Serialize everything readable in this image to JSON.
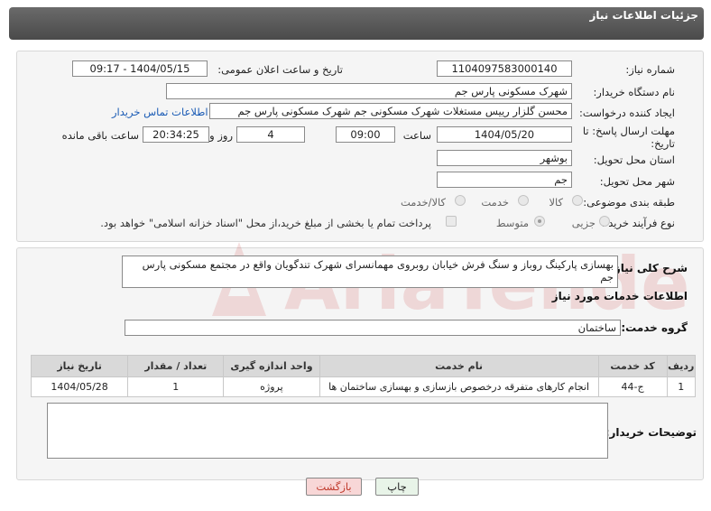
{
  "header": {
    "title": "جزئیات اطلاعات نیاز"
  },
  "labels": {
    "need_number": "شماره نیاز:",
    "announce_datetime": "تاریخ و ساعت اعلان عمومی:",
    "buyer_org": "نام دستگاه خریدار:",
    "requester": "ایجاد کننده درخواست:",
    "deadline": "مهلت ارسال پاسخ: تا تاریخ:",
    "time": "ساعت",
    "days_and": "روز و",
    "remaining": "ساعت باقی مانده",
    "province": "استان محل تحویل:",
    "city": "شهر محل تحویل:",
    "category": "طبقه بندی موضوعی:",
    "process_type": "نوع فرآیند خرید :",
    "general_desc": "شرح کلی نیاز:",
    "services_info": "اطلاعات خدمات مورد نیاز",
    "service_group": "گروه خدمت:",
    "buyer_notes": "توضیحات خریدار:"
  },
  "fields": {
    "need_number": "1104097583000140",
    "announce_datetime": "1404/05/15 - 09:17",
    "buyer_org": "شهرک مسکونی پارس جم",
    "requester": "محسن گلزار رییس مستغلات شهرک مسکونی جم شهرک مسکونی پارس جم",
    "contact_link": "اطلاعات تماس خریدار",
    "deadline_date": "1404/05/20",
    "deadline_time": "09:00",
    "days": "4",
    "remaining_time": "20:34:25",
    "province": "بوشهر",
    "city": "جم",
    "general_desc": "بهسازی پارکینگ روباز و سنگ فرش خیابان روبروی مهمانسرای شهرک تندگویان واقع در مجتمع مسکونی پارس جم",
    "service_group": "ساختمان",
    "buyer_notes": ""
  },
  "category_options": [
    {
      "label": "کالا",
      "selected": false
    },
    {
      "label": "خدمت",
      "selected": false
    },
    {
      "label": "کالا/خدمت",
      "selected": false
    }
  ],
  "process_options": [
    {
      "label": "جزیی",
      "selected": false
    },
    {
      "label": "متوسط",
      "selected": true
    }
  ],
  "payment_note": "پرداخت تمام یا بخشی از مبلغ خرید،از محل \"اسناد خزانه اسلامی\" خواهد بود.",
  "table": {
    "headers": [
      "ردیف",
      "کد خدمت",
      "نام خدمت",
      "واحد اندازه گیری",
      "تعداد / مقدار",
      "تاریخ نیاز"
    ],
    "rows": [
      [
        "1",
        "ج-44",
        "انجام کارهای متفرقه درخصوص بازسازی و بهسازی ساختمان ها",
        "پروژه",
        "1",
        "1404/05/28"
      ]
    ]
  },
  "buttons": {
    "print": "چاپ",
    "back": "بازگشت"
  },
  "watermark": {
    "text": "AriaTender.neT"
  },
  "colors": {
    "header_bg": "#555555",
    "link": "#1a5bb5",
    "back_text": "#c0392b",
    "watermark": "#c62828"
  }
}
